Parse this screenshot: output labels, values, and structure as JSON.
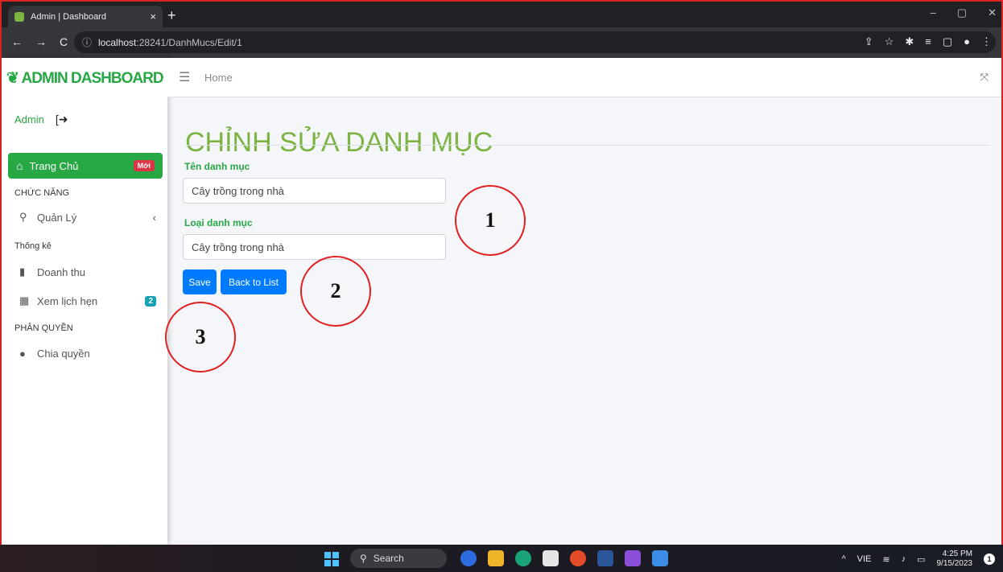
{
  "browser": {
    "tab_title": "Admin | Dashboard",
    "url_prefix": "ⓘ",
    "url_host": "localhost",
    "url_rest": ":28241/DanhMucs/Edit/1",
    "controls": {
      "back": "←",
      "forward": "→",
      "reload": "C",
      "new_tab": "+",
      "close_tab": "×",
      "minimize": "–",
      "maximize": "▢",
      "close": "✕"
    }
  },
  "sidebar": {
    "brand": "ADMIN DASHBOARD",
    "user": "Admin",
    "active_item": {
      "label": "Trang Chủ",
      "badge": "Mới"
    },
    "section_features": "CHỨC NĂNG",
    "item_manage": "Quản Lý",
    "section_stats": "Thống kê",
    "item_revenue": "Doanh thu",
    "item_appointments": {
      "label": "Xem lịch hẹn",
      "badge": "2"
    },
    "section_perm": "PHÂN QUYỀN",
    "item_perm": "Chia quyền"
  },
  "topnav": {
    "home": "Home"
  },
  "main": {
    "title": "CHỈNH SỬA DANH MỤC",
    "field1_label": "Tên danh mục",
    "field1_value": "Cây trồng trong nhà",
    "field2_label": "Loại danh mục",
    "field2_value": "Cây trồng trong nhà",
    "save_label": "Save",
    "back_label": "Back to List"
  },
  "annotations": [
    "1",
    "2",
    "3"
  ],
  "taskbar": {
    "search": "Search",
    "lang": "VIE",
    "time": "4:25 PM",
    "date": "9/15/2023",
    "notif_count": "1"
  },
  "colors": {
    "accent_green": "#28a745",
    "title_green": "#7cb342",
    "primary_blue": "#007bff",
    "badge_red": "#dc3545",
    "badge_teal": "#17a2b8"
  }
}
